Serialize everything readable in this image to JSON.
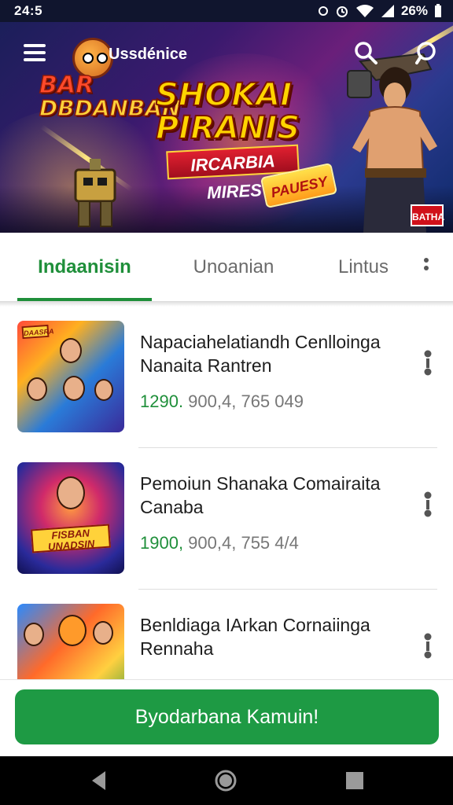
{
  "status_bar": {
    "time": "24:5",
    "battery": "26%",
    "icons": [
      "notification-icon",
      "alarm-icon",
      "wifi-icon",
      "signal-icon",
      "battery-icon"
    ]
  },
  "header": {
    "app_title": "Ussdénice",
    "logo_line1": "BAR",
    "logo_line2": "DBDANBAN",
    "menu_icon": "menu-icon",
    "search_icon": "search-icon",
    "chat_icon": "chat-icon"
  },
  "hero": {
    "title_line1": "SHOKAI",
    "title_line2": "PIRANIS",
    "ribbon": "IRCARBIA MIRES",
    "tag": "PAUESY",
    "corner_tag": "BATHA"
  },
  "tabs": {
    "items": [
      {
        "label": "Indaanisin",
        "active": true
      },
      {
        "label": "Unoanian",
        "active": false
      },
      {
        "label": "Lintus",
        "active": false
      }
    ],
    "more_icon": "more-vertical-icon"
  },
  "list": {
    "items": [
      {
        "title": "Napaciahelatiandh Cenlloinga Nanaita Rantren",
        "meta_green": "1290.",
        "meta_rest": " 900,4, 765 049",
        "thumb_badge": "DAASRA"
      },
      {
        "title": "Pemoiun Shanaka Comairaita Canaba",
        "meta_green": "1900,",
        "meta_rest": " 900,4, 755 4/4",
        "thumb_badge": "FISBAN UNADSIN"
      },
      {
        "title": "Benldiaga IArkan Cornaiinga Rennaha",
        "meta_green": "",
        "meta_rest": "",
        "thumb_badge": ""
      }
    ]
  },
  "cta": {
    "label": "Byodarbana Kamuin!"
  },
  "navbar": {
    "back_icon": "back-icon",
    "home_icon": "home-icon",
    "recents_icon": "recents-icon"
  },
  "colors": {
    "accent_green": "#1f8f3a",
    "cta_green": "#1e9a44",
    "status_bar": "#10152e"
  }
}
